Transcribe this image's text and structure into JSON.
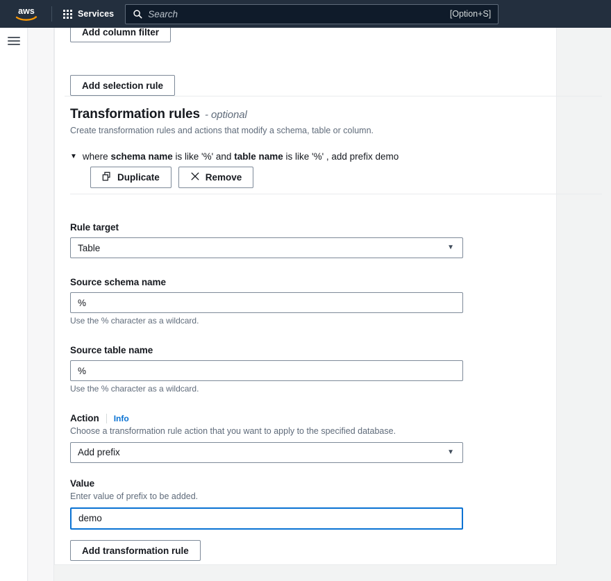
{
  "nav": {
    "logo_name": "aws",
    "services_label": "Services",
    "search_placeholder": "Search",
    "search_value": "",
    "search_shortcut": "[Option+S]"
  },
  "sidebar": {
    "menu_icon": "hamburger-icon"
  },
  "buttons": {
    "add_column_filter": "Add column filter",
    "add_selection_rule": "Add selection rule",
    "duplicate": "Duplicate",
    "remove": "Remove",
    "add_transformation_rule": "Add transformation rule"
  },
  "section": {
    "title": "Transformation rules",
    "optional": "- optional",
    "description": "Create transformation rules and actions that modify a schema, table or column."
  },
  "rule_summary": {
    "caret": "▼",
    "part1": "where ",
    "bold1": "schema name",
    "part2": " is like '%' and ",
    "bold2": "table name",
    "part3": " is like '%' , add prefix demo"
  },
  "fields": {
    "rule_target": {
      "label": "Rule target",
      "value": "Table",
      "options": [
        "Table"
      ]
    },
    "source_schema_name": {
      "label": "Source schema name",
      "value": "%",
      "hint": "Use the % character as a wildcard."
    },
    "source_table_name": {
      "label": "Source table name",
      "value": "%",
      "hint": "Use the % character as a wildcard."
    },
    "action": {
      "label": "Action",
      "info": "Info",
      "description": "Choose a transformation rule action that you want to apply to the specified database.",
      "value": "Add prefix",
      "options": [
        "Add prefix"
      ]
    },
    "value": {
      "label": "Value",
      "description": "Enter value of prefix to be added.",
      "value": "demo"
    }
  },
  "colors": {
    "nav_background": "#232f3e",
    "accent_blue": "#0972d3",
    "page_background": "#f2f3f3",
    "border": "#7d8998",
    "muted_text": "#5f6b7a"
  }
}
